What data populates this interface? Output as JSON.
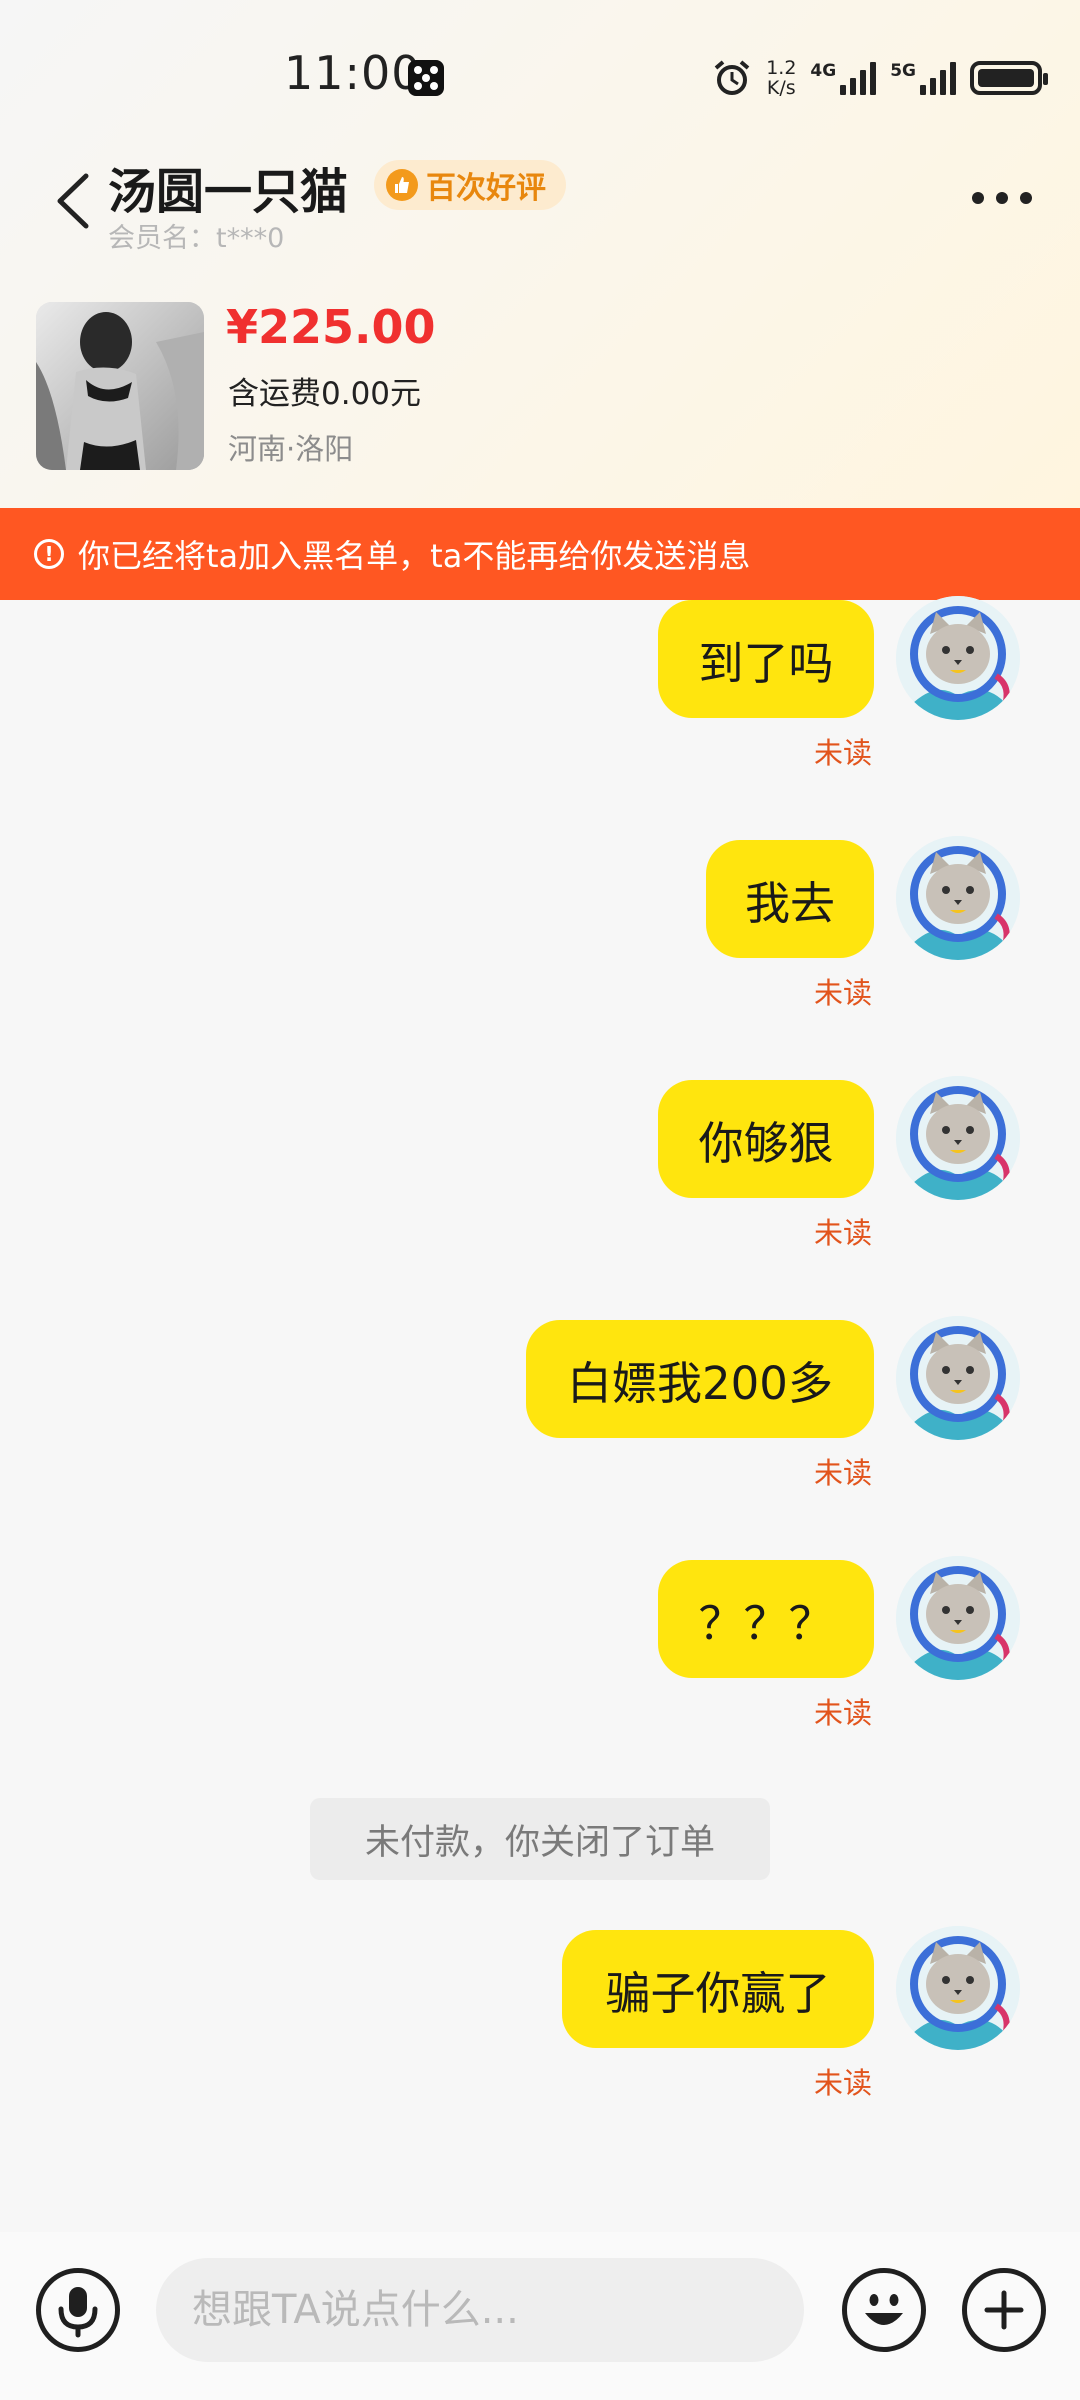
{
  "status_bar": {
    "time": "11:00",
    "speed_value": "1.2",
    "speed_unit": "K/s",
    "net1": "4G",
    "net2": "5G"
  },
  "header": {
    "name": "汤圆一只猫",
    "badge": "百次好评",
    "member": "会员名：t***0"
  },
  "product": {
    "price": "¥225.00",
    "shipping": "含运费0.00元",
    "location": "河南·洛阳"
  },
  "banner": {
    "text": "你已经将ta加入黑名单，ta不能再给你发送消息"
  },
  "messages": [
    {
      "text": "到了吗",
      "status": "未读"
    },
    {
      "text": "我去",
      "status": "未读"
    },
    {
      "text": "你够狠",
      "status": "未读"
    },
    {
      "text": "白嫖我200多",
      "status": "未读"
    },
    {
      "text": "？？？",
      "status": "未读"
    },
    {
      "text": "骗子你赢了",
      "status": "未读"
    }
  ],
  "system_message": "未付款，你关闭了订单",
  "input": {
    "placeholder": "想跟TA说点什么..."
  },
  "colors": {
    "bubble": "#ffe50e",
    "banner": "#ff5722",
    "price": "#f0302f",
    "unread": "#e2541c"
  }
}
